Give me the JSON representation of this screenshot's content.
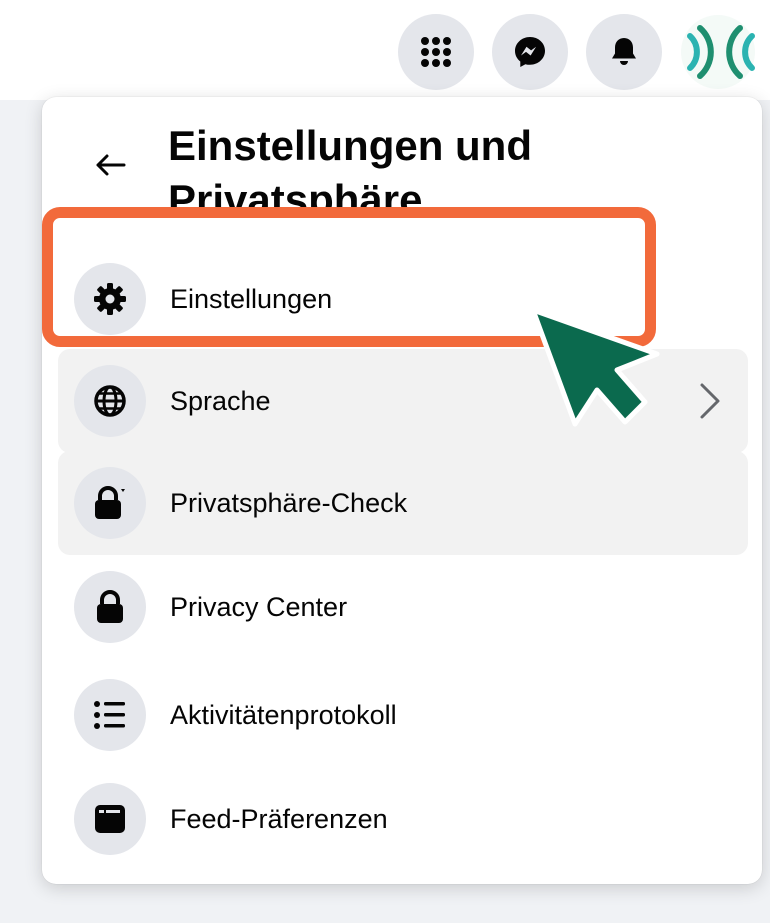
{
  "topbar": {
    "menu_icon": "grid-menu-icon",
    "messenger_icon": "messenger-icon",
    "notifications_icon": "bell-icon",
    "avatar_icon": "profile-avatar"
  },
  "panel": {
    "title": "Einstellungen und Privatsphäre",
    "back_icon": "back-arrow-icon",
    "items": [
      {
        "label": "Einstellungen",
        "icon": "gear-icon"
      },
      {
        "label": "Sprache",
        "icon": "globe-icon",
        "has_chevron": true
      },
      {
        "label": "Privatsphäre-Check",
        "icon": "lock-check-icon"
      },
      {
        "label": "Privacy Center",
        "icon": "lock-icon"
      },
      {
        "label": "Aktivitätenprotokoll",
        "icon": "list-icon"
      },
      {
        "label": "Feed-Präferenzen",
        "icon": "feed-icon"
      }
    ]
  },
  "annotation": {
    "highlight_color": "#f26a3b",
    "cursor_color": "#0b6a4e"
  }
}
